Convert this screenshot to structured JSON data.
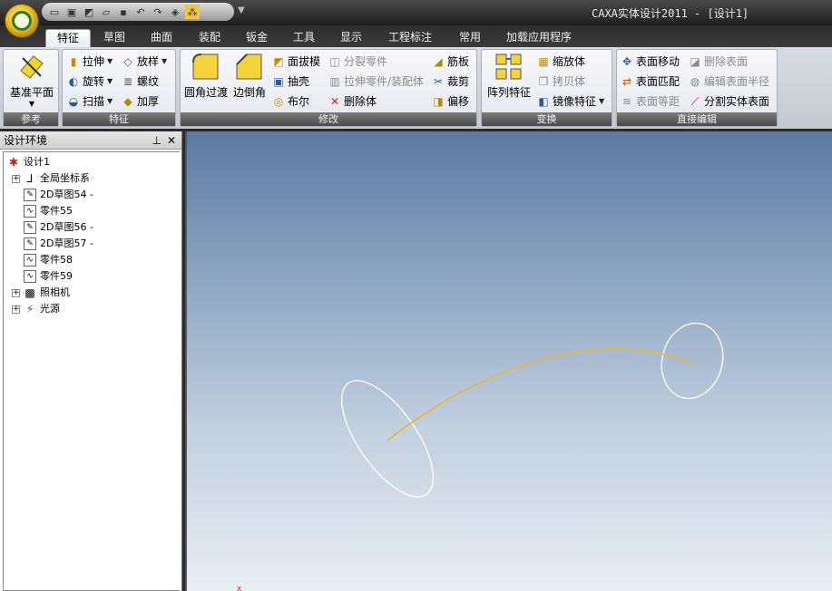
{
  "window": {
    "title": "CAXA实体设计2011 - [设计1]"
  },
  "quick_access": {
    "icons": [
      "new-icon",
      "print-icon",
      "save-as-icon",
      "open-icon",
      "save-icon",
      "undo-icon",
      "redo-icon",
      "diamond-icon",
      "smart-icon"
    ]
  },
  "tabs": [
    "特征",
    "草图",
    "曲面",
    "装配",
    "钣金",
    "工具",
    "显示",
    "工程标注",
    "常用",
    "加载应用程序"
  ],
  "active_tab": "特征",
  "ribbon": {
    "reference": {
      "label": "参考",
      "datum_plane": "基准平面"
    },
    "feature": {
      "label": "特征",
      "extrude": "拉伸",
      "revolve": "旋转",
      "sweep": "扫描",
      "loft": "放样",
      "thread": "螺纹",
      "thicken": "加厚"
    },
    "modify": {
      "label": "修改",
      "fillet": "圆角过渡",
      "chamfer": "边倒角",
      "draft": "面拔模",
      "shell": "抽壳",
      "boolean": "布尔",
      "split_part": "分裂零件",
      "extrude_part": "拉伸零件/装配体",
      "delete_body": "删除体",
      "rib": "筋板",
      "trim": "裁剪",
      "offset": "偏移"
    },
    "transform": {
      "label": "变换",
      "pattern": "阵列特征",
      "scale": "缩放体",
      "copy_body": "拷贝体",
      "mirror": "镜像特征"
    },
    "direct_edit": {
      "label": "直接编辑",
      "move_face": "表面移动",
      "match_face": "表面匹配",
      "offset_face": "表面等距",
      "delete_face": "删除表面",
      "edit_radius": "编辑表面半径",
      "split_solid": "分割实体表面"
    }
  },
  "design_panel": {
    "title": "设计环境",
    "pin": "ㅁ",
    "close": "✕",
    "nodes": [
      {
        "label": "设计1",
        "icon": "design-icon"
      },
      {
        "label": "全局坐标系",
        "icon": "axes-icon",
        "expander": "+"
      },
      {
        "label": "2D草图54 -",
        "icon": "sketch-icon"
      },
      {
        "label": "零件55",
        "icon": "part-icon"
      },
      {
        "label": "2D草图56 -",
        "icon": "sketch-icon"
      },
      {
        "label": "2D草图57 -",
        "icon": "sketch-icon"
      },
      {
        "label": "零件58",
        "icon": "part-icon"
      },
      {
        "label": "零件59",
        "icon": "part-icon"
      },
      {
        "label": "照相机",
        "icon": "camera-icon",
        "expander": "+"
      },
      {
        "label": "光源",
        "icon": "light-icon",
        "expander": "+"
      }
    ]
  },
  "colors": {
    "curve": "#e8b83a",
    "ellipse": "#ffffff",
    "accent": "#f0c020"
  }
}
